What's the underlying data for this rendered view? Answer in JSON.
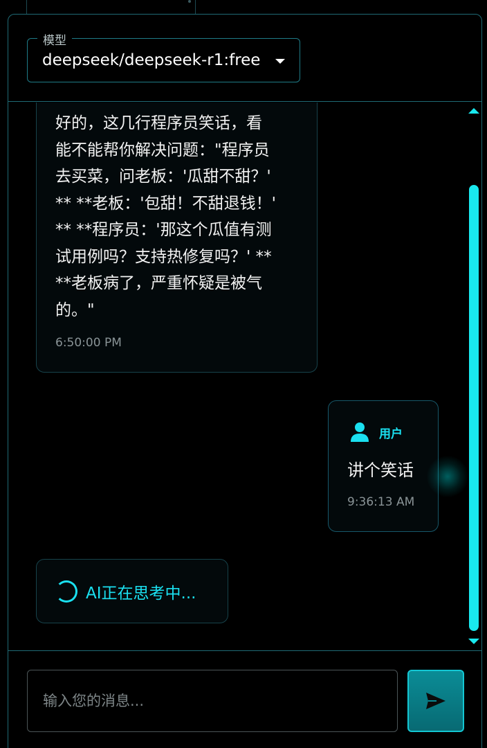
{
  "model": {
    "legend": "模型",
    "value": "deepseek/deepseek-r1:free"
  },
  "messages": {
    "ai": {
      "text": "好的，这几行程序员笑话，看\n能不能帮你解决问题：\"程序员\n去买菜，问老板：'瓜甜不甜？'\n** **老板：'包甜！不甜退钱！'\n** **程序员：'那这个瓜值有测\n试用例吗？支持热修复吗？' **\n**老板病了，严重怀疑是被气\n的。\"",
      "time": "6:50:00 PM"
    },
    "user": {
      "label": "用户",
      "text": "讲个笑话",
      "time": "9:36:13 AM"
    },
    "thinking": {
      "text": "AI正在思考中..."
    }
  },
  "input": {
    "placeholder": "输入您的消息..."
  },
  "icons": {
    "user": "user-icon",
    "send": "send-icon",
    "spinner": "spinner-icon",
    "caret": "chevron-down-icon"
  },
  "colors": {
    "accent": "#1ae0f0",
    "border": "#1f6a75",
    "send_button": "#0a8c96"
  }
}
